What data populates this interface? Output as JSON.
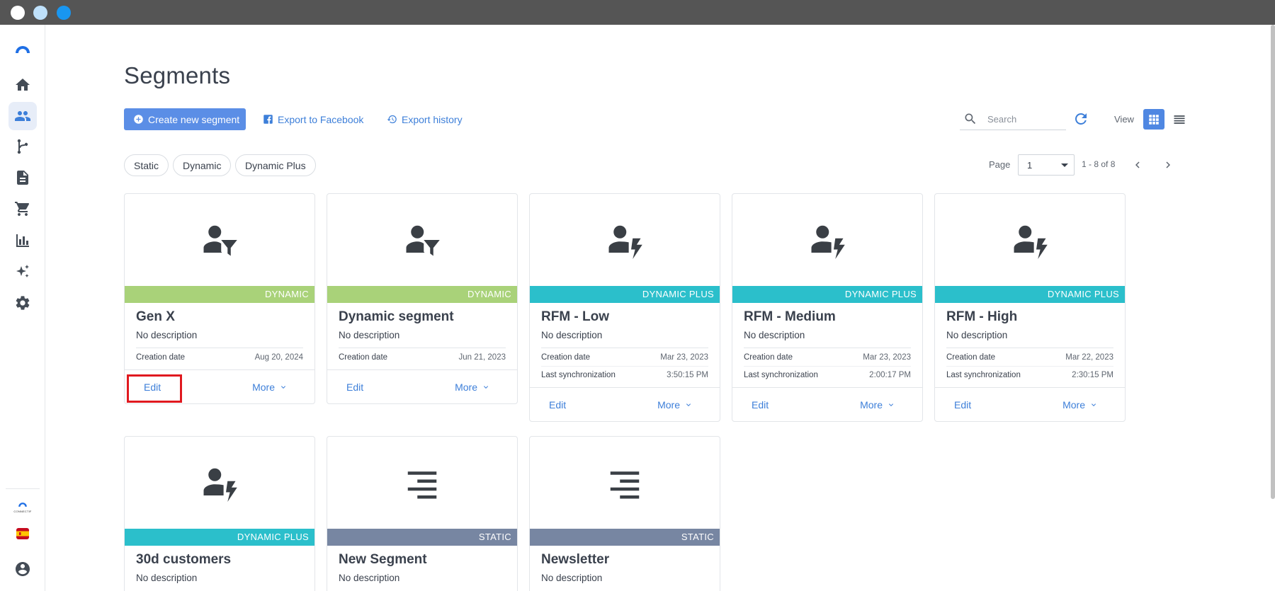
{
  "window": {
    "traffic_lights": [
      "#ffffff",
      "#bfe1fb",
      "#1996f0"
    ]
  },
  "sidebar": {
    "items": [
      {
        "name": "home-icon",
        "active": false
      },
      {
        "name": "users-icon",
        "active": true
      },
      {
        "name": "flow-icon",
        "active": false
      },
      {
        "name": "document-icon",
        "active": false
      },
      {
        "name": "cart-icon",
        "active": false
      },
      {
        "name": "bar-chart-icon",
        "active": false
      },
      {
        "name": "sparkles-icon",
        "active": false
      },
      {
        "name": "gear-icon",
        "active": false
      }
    ],
    "bottom": {
      "brand_text": "CONNECTIF",
      "language_flag": "spain-flag-icon",
      "profile_icon": "account-circle-icon"
    }
  },
  "header": {
    "title": "Segments"
  },
  "toolbar": {
    "create_label": "Create new segment",
    "export_facebook_label": "Export to Facebook",
    "export_history_label": "Export history",
    "search_placeholder": "Search",
    "view_label": "View",
    "view_mode": "grid"
  },
  "filters": {
    "chips": [
      "Static",
      "Dynamic",
      "Dynamic Plus"
    ]
  },
  "pagination": {
    "page_label": "Page",
    "current_page": "1",
    "range": "1 - 8 of 8"
  },
  "colors": {
    "accent": "#3d7fd9",
    "dynamic": "#a9d279",
    "dynamic_plus": "#2bbfcb",
    "static": "#7786a2",
    "highlight": "#e0191f"
  },
  "cards": [
    {
      "name": "Gen X",
      "description": "No description",
      "type": "DYNAMIC",
      "icon": "person-filter-icon",
      "creation_label": "Creation date",
      "creation_date": "Aug 20, 2024",
      "sync_label": "",
      "sync_time": "",
      "edit_label": "Edit",
      "more_label": "More"
    },
    {
      "name": "Dynamic segment",
      "description": "No description",
      "type": "DYNAMIC",
      "icon": "person-filter-icon",
      "creation_label": "Creation date",
      "creation_date": "Jun 21, 2023",
      "sync_label": "",
      "sync_time": "",
      "edit_label": "Edit",
      "more_label": "More"
    },
    {
      "name": "RFM - Low",
      "description": "No description",
      "type": "DYNAMIC PLUS",
      "icon": "person-bolt-icon",
      "creation_label": "Creation date",
      "creation_date": "Mar 23, 2023",
      "sync_label": "Last synchronization",
      "sync_time": "3:50:15 PM",
      "edit_label": "Edit",
      "more_label": "More"
    },
    {
      "name": "RFM - Medium",
      "description": "No description",
      "type": "DYNAMIC PLUS",
      "icon": "person-bolt-icon",
      "creation_label": "Creation date",
      "creation_date": "Mar 23, 2023",
      "sync_label": "Last synchronization",
      "sync_time": "2:00:17 PM",
      "edit_label": "Edit",
      "more_label": "More"
    },
    {
      "name": "RFM - High",
      "description": "No description",
      "type": "DYNAMIC PLUS",
      "icon": "person-bolt-icon",
      "creation_label": "Creation date",
      "creation_date": "Mar 22, 2023",
      "sync_label": "Last synchronization",
      "sync_time": "2:30:15 PM",
      "edit_label": "Edit",
      "more_label": "More"
    },
    {
      "name": "30d customers",
      "description": "No description",
      "type": "DYNAMIC PLUS",
      "icon": "person-bolt-icon"
    },
    {
      "name": "New Segment",
      "description": "No description",
      "type": "STATIC",
      "icon": "lines-icon"
    },
    {
      "name": "Newsletter",
      "description": "No description",
      "type": "STATIC",
      "icon": "lines-icon"
    }
  ]
}
